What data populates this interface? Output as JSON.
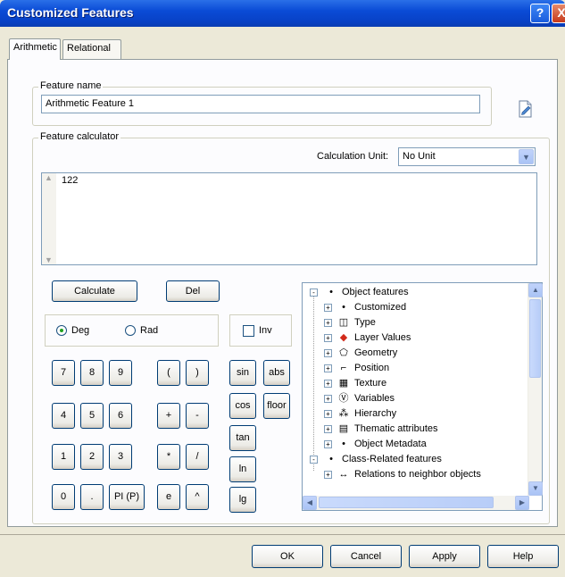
{
  "window": {
    "title": "Customized Features",
    "help_glyph": "?",
    "close_glyph": "X"
  },
  "tabs": [
    {
      "label": "Arithmetic"
    },
    {
      "label": "Relational"
    }
  ],
  "feature_name": {
    "label": "Feature name",
    "value": "Arithmetic Feature 1"
  },
  "calculator": {
    "label": "Feature calculator",
    "unit_label": "Calculation Unit:",
    "unit_value": "No Unit",
    "expression": "122",
    "calculate": "Calculate",
    "del": "Del",
    "deg": "Deg",
    "rad": "Rad",
    "inv": "Inv",
    "keys": [
      "7",
      "8",
      "9",
      "(",
      ")",
      "4",
      "5",
      "6",
      "+",
      "-",
      "1",
      "2",
      "3",
      "*",
      "/",
      "0",
      ".",
      "PI (P)",
      "e",
      "^"
    ],
    "funcs": [
      "sin",
      "abs",
      "cos",
      "floor",
      "tan",
      "ln",
      "lg"
    ]
  },
  "tree": [
    {
      "label": "Object features",
      "sign": "-",
      "icon": "•"
    },
    {
      "label": "Customized",
      "sign": "+",
      "icon": "•"
    },
    {
      "label": "Type",
      "sign": "+",
      "icon": "◫"
    },
    {
      "label": "Layer Values",
      "sign": "+",
      "icon": "◆"
    },
    {
      "label": "Geometry",
      "sign": "+",
      "icon": "⬠"
    },
    {
      "label": "Position",
      "sign": "+",
      "icon": "⌐"
    },
    {
      "label": "Texture",
      "sign": "+",
      "icon": "▦"
    },
    {
      "label": "Variables",
      "sign": "+",
      "icon": "Ⓥ"
    },
    {
      "label": "Hierarchy",
      "sign": "+",
      "icon": "⁂"
    },
    {
      "label": "Thematic attributes",
      "sign": "+",
      "icon": "▤"
    },
    {
      "label": "Object Metadata",
      "sign": "+",
      "icon": "•"
    },
    {
      "label": "Class-Related features",
      "sign": "-",
      "icon": "•"
    },
    {
      "label": "Relations to neighbor objects",
      "sign": "+",
      "icon": "↔"
    }
  ],
  "footer": {
    "ok": "OK",
    "cancel": "Cancel",
    "apply": "Apply",
    "help": "Help"
  }
}
